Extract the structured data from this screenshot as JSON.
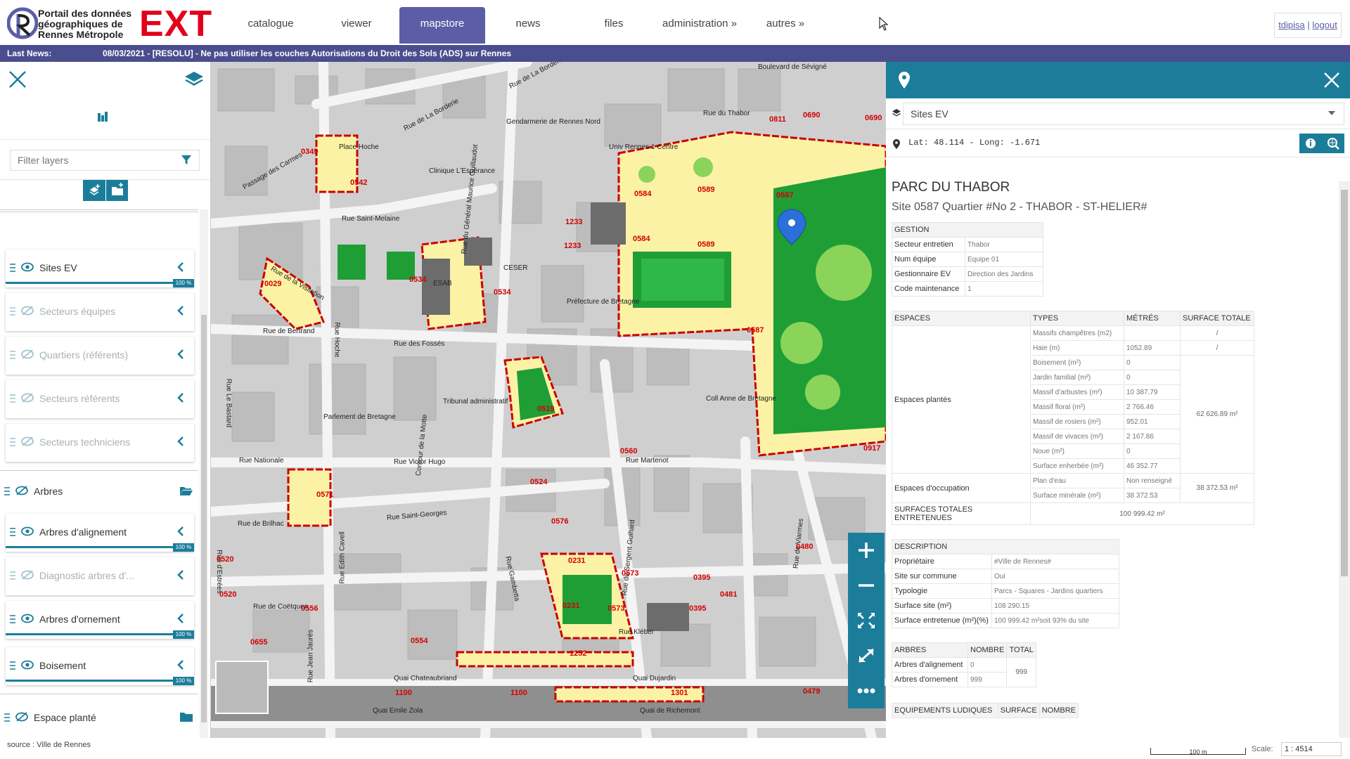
{
  "header": {
    "logo_text": "Portail des données géographiques de Rennes Métropole",
    "logo_ext": "EXT",
    "nav": [
      "catalogue",
      "viewer",
      "mapstore",
      "news",
      "files",
      "administration »",
      "autres »"
    ],
    "active_nav": "mapstore",
    "user": "tdipisa",
    "logout": "logout"
  },
  "news": {
    "label": "Last News:",
    "text": "08/03/2021 - [RESOLU] - Ne pas utiliser les couches Autorisations du Droit des Sols (ADS) sur Rennes"
  },
  "left_panel": {
    "filter_placeholder": "Filter layers",
    "layers": [
      {
        "name": "Sites EV",
        "visible": true,
        "opacity": "100 %"
      },
      {
        "name": "Secteurs équipes",
        "visible": false
      },
      {
        "name": "Quartiers (référents)",
        "visible": false
      },
      {
        "name": "Secteurs référents",
        "visible": false
      },
      {
        "name": "Secteurs techniciens",
        "visible": false
      }
    ],
    "group_arbres": "Arbres",
    "arbres_layers": [
      {
        "name": "Arbres d'alignement",
        "visible": true,
        "opacity": "100 %"
      },
      {
        "name": "Diagnostic arbres d'...",
        "visible": false
      },
      {
        "name": "Arbres d'ornement",
        "visible": true,
        "opacity": "100 %"
      },
      {
        "name": "Boisement",
        "visible": true,
        "opacity": "100 %"
      }
    ],
    "group_espace": "Espace planté"
  },
  "map": {
    "streets": [
      "Boulevard de Sévigné",
      "Rue de La Borderie",
      "Rue du Thabor",
      "Place Hoche",
      "Rue de La Borderie",
      "Rue Saint-Melaine",
      "Passage des Carmes",
      "Rue de la Visitation",
      "Rue de Bertrand",
      "Rue des Fossés",
      "Rue Hoche",
      "Rue Le Bastard",
      "Rue Nationale",
      "Rue Victor Hugo",
      "Rue Martenot",
      "Rue de Brilhac",
      "Rue Saint-Georges",
      "Rue Kléber",
      "Quai Chateaubriand",
      "Quai Dujardin",
      "Quai Emile Zola",
      "Quai de Richemont",
      "Rue du Général Maurice Guillaudot",
      "Contour de la Motte",
      "Rue Gambetta",
      "Rue de Coëtquen",
      "Rue Jean Jaurès",
      "Rue Edith Cavell",
      "Rue du Sergent Guihard",
      "Rue de Viarmes",
      "Rue d'Estrées"
    ],
    "buildings": [
      "Préfecture de Bretagne",
      "Parlement de Bretagne",
      "Tribunal administratif",
      "Gendarmerie de Rennes Nord",
      "Clinique L'Espérance",
      "Univ Rennes 1 Centre",
      "CESER",
      "ESAB",
      "Coll Anne de Bretagne"
    ],
    "sites": [
      "0349",
      "0542",
      "0029",
      "0534",
      "0534",
      "0584",
      "0584",
      "0589",
      "0589",
      "0587",
      "0587",
      "1233",
      "1233",
      "0519",
      "0560",
      "0571",
      "0524",
      "0576",
      "0231",
      "0231",
      "0573",
      "0573",
      "0395",
      "0395",
      "0481",
      "0480",
      "0520",
      "0520",
      "0556",
      "0655",
      "0554",
      "1252",
      "1100",
      "1100",
      "1301",
      "0479",
      "0917",
      "0690",
      "0690",
      "0811"
    ],
    "zoom_in": "+",
    "zoom_out": "−"
  },
  "right_panel": {
    "layer_select": "Sites EV",
    "coords": "Lat: 48.114 - Long: -1.671",
    "title": "PARC DU THABOR",
    "subtitle": "Site 0587 Quartier #No 2 - THABOR - ST-HELIER#",
    "gestion": {
      "header": "GESTION",
      "rows": [
        [
          "Secteur entretien",
          "Thabor"
        ],
        [
          "Num équipe",
          "Equipe 01"
        ],
        [
          "Gestionnaire EV",
          "Direction des Jardins"
        ],
        [
          "Code maintenance",
          "1"
        ]
      ]
    },
    "espaces": {
      "headers": [
        "ESPACES",
        "TYPES",
        "MÉTRÉS",
        "SURFACE TOTALE"
      ],
      "plantes_label": "Espaces plantés",
      "plantes_rows": [
        [
          "Massifs champêtres (m2)",
          "",
          "/"
        ],
        [
          "Haie (m)",
          "1052.89",
          "/"
        ],
        [
          "Boisement (m²)",
          "0",
          ""
        ],
        [
          "Jardin familial (m²)",
          "0",
          ""
        ],
        [
          "Massif d'arbustes (m²)",
          "10 387.79",
          ""
        ],
        [
          "Massif floral (m²)",
          "2 766.46",
          ""
        ],
        [
          "Massif de rosiers (m²)",
          "952.01",
          ""
        ],
        [
          "Massif de vivaces (m²)",
          "2 167.86",
          ""
        ],
        [
          "Noue (m²)",
          "0",
          ""
        ],
        [
          "Surface enherbée (m²)",
          "46 352.77",
          ""
        ]
      ],
      "plantes_total": "62 626.89 m²",
      "occupation_label": "Espaces d'occupation",
      "occupation_rows": [
        [
          "Plan d'eau",
          "Non renseigné"
        ],
        [
          "Surface minérale (m²)",
          "38 372.53"
        ]
      ],
      "occupation_total": "38 372.53 m²",
      "totals_label": "SURFACES TOTALES ENTRETENUES",
      "totals_value": "100 999.42 m²"
    },
    "description": {
      "header": "DESCRIPTION",
      "rows": [
        [
          "Propriétaire",
          "#Ville de Rennes#"
        ],
        [
          "Site sur commune",
          "Oui"
        ],
        [
          "Typologie",
          "Parcs - Squares - Jardins quartiers"
        ],
        [
          "Surface site (m²)",
          "108 290.15"
        ],
        [
          "Surface entretenue (m²)(%)",
          "100 999.42 m²soit 93% du site"
        ]
      ]
    },
    "arbres": {
      "headers": [
        "ARBRES",
        "NOMBRE",
        "TOTAL"
      ],
      "rows": [
        [
          "Arbres d'alignement",
          "0"
        ],
        [
          "Arbres d'ornement",
          "999"
        ]
      ],
      "total": "999"
    },
    "equipements": {
      "headers": [
        "EQUIPEMENTS LUDIQUES",
        "SURFACE",
        "NOMBRE"
      ]
    }
  },
  "footer": {
    "source": "source : Ville de Rennes",
    "scale_bar": "100 m",
    "scale_label": "Scale:",
    "scale_value": "1 : 4514"
  }
}
